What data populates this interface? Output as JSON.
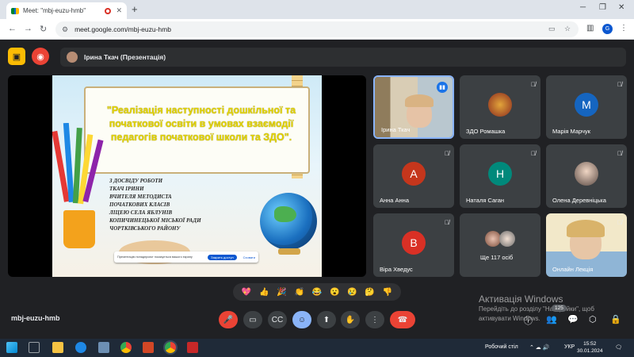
{
  "browser": {
    "tab_title": "Meet: \"mbj-euzu-hmb\"",
    "new_tab": "+",
    "tab_close": "✕",
    "url": "meet.google.com/mbj-euzu-hmb",
    "profile_initial": "G"
  },
  "meet": {
    "presenter_label": "Ірина Ткач (Презентація)",
    "meeting_code": "mbj-euzu-hmb",
    "participants_badge": "125"
  },
  "slide": {
    "title": "\"Реалізація наступності дошкільної та початкової освіти в умовах взаємодії педагогів початкової школи та ЗДО\".",
    "body_lines": [
      "З ДОСВІДУ РОБОТИ",
      "ТКАЧ ІРИНИ",
      "ВЧИТЕЛЯ МЕТОДИСТА",
      "ПОЧАТКОВИХ КЛАСІВ",
      "ЛІЦЕЮ СЕЛА ЯБЛУНІВ",
      "КОПИЧИНЕЦЬКОЇ МІСЬКОЇ РАДИ",
      "ЧОРТКІВСЬКОГО РАЙОНУ"
    ],
    "share_banner": {
      "text": "Презентацію понадпроєкт показується вашого екрану",
      "stop_label": "Закрить доступ",
      "hide_label": "Сховати"
    }
  },
  "tiles": [
    {
      "name": "Ірина Ткач",
      "type": "video",
      "speaking": true
    },
    {
      "name": "ЗДО Ромашка",
      "type": "image",
      "muted": true
    },
    {
      "name": "Марія Марчук",
      "type": "initial",
      "initial": "М",
      "color": "#1565c0",
      "muted": true
    },
    {
      "name": "Анна Анна",
      "type": "initial",
      "initial": "А",
      "color": "#c5361c",
      "muted": true
    },
    {
      "name": "Наталя Саган",
      "type": "initial",
      "initial": "Н",
      "color": "#00897b",
      "muted": true
    },
    {
      "name": "Олена Деревніцька",
      "type": "image",
      "muted": true
    },
    {
      "name": "Віра Хведус",
      "type": "initial",
      "initial": "В",
      "color": "#d93025",
      "muted": true
    },
    {
      "name": "Ще 117 осіб",
      "type": "group"
    },
    {
      "name": "Онлайн Лекція",
      "type": "video",
      "muted": true
    }
  ],
  "reactions": [
    "💖",
    "👍",
    "🎉",
    "👏",
    "😂",
    "😮",
    "😢",
    "🤔",
    "👎"
  ],
  "watermark": {
    "title": "Активація Windows",
    "line1": "Перейдіть до розділу \"Настройки\", щоб",
    "line2": "активувати Windows."
  },
  "taskbar": {
    "desktop_label": "Робочий стіл",
    "lang": "УКР",
    "time": "15:52",
    "date": "30.01.2024"
  },
  "icons": {
    "mic_off": "🎤",
    "speaking": "▮▮"
  }
}
